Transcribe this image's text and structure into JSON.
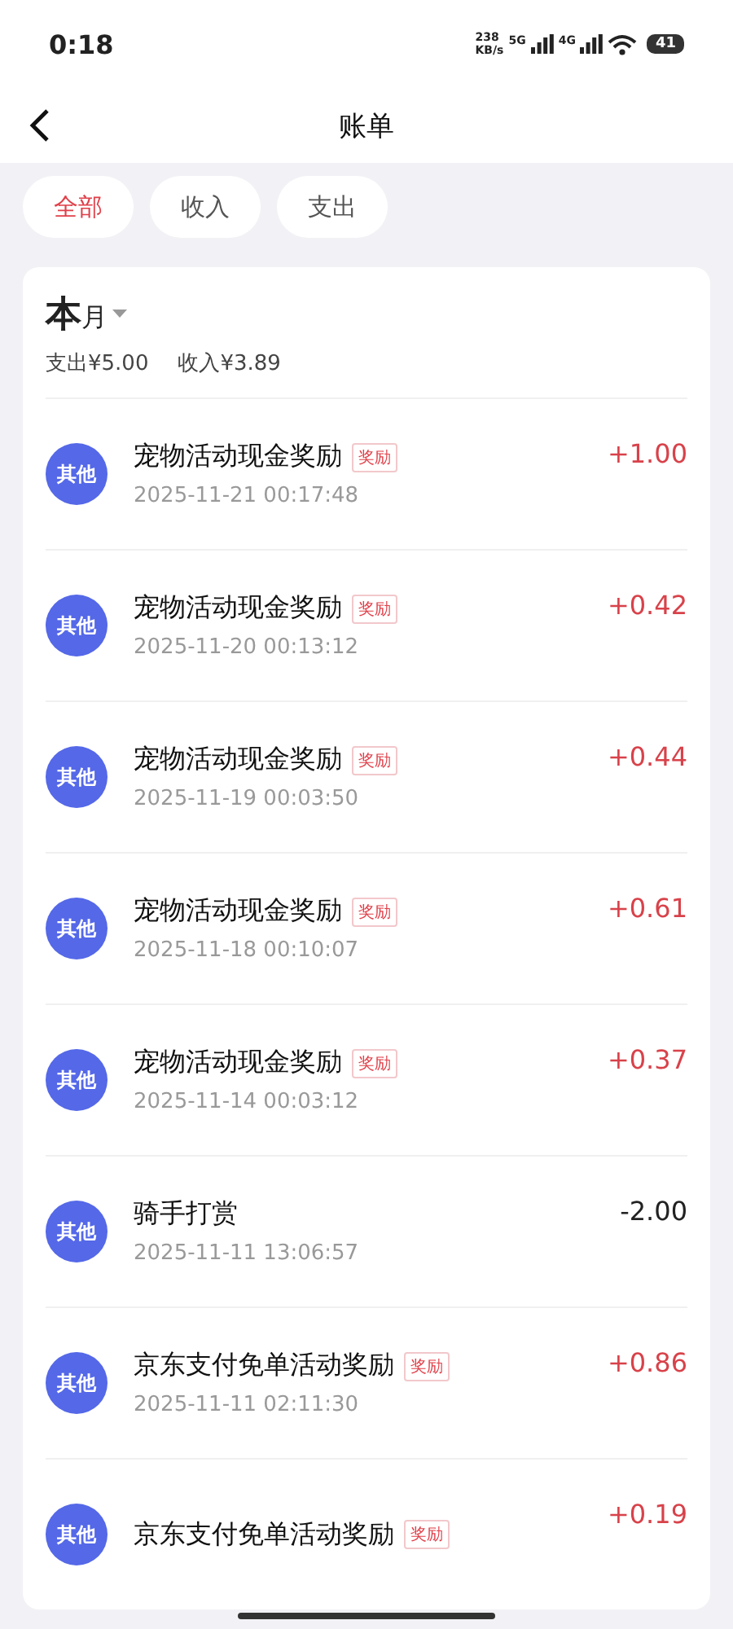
{
  "status_bar": {
    "time": "0:18",
    "net_speed": "238",
    "net_unit": "KB/s",
    "signal_1": "5G",
    "signal_2": "4G",
    "battery": "41"
  },
  "nav": {
    "title": "账单"
  },
  "filters": [
    {
      "label": "全部",
      "selected": true
    },
    {
      "label": "收入",
      "selected": false
    },
    {
      "label": "支出",
      "selected": false
    }
  ],
  "period": {
    "big": "本",
    "small": "月",
    "expense": "支出¥5.00",
    "income": "收入¥3.89"
  },
  "records": [
    {
      "category": "其他",
      "title": "宠物活动现金奖励",
      "tag": "奖励",
      "time": "2025-11-21 00:17:48",
      "amount": "+1.00",
      "kind": "income"
    },
    {
      "category": "其他",
      "title": "宠物活动现金奖励",
      "tag": "奖励",
      "time": "2025-11-20 00:13:12",
      "amount": "+0.42",
      "kind": "income"
    },
    {
      "category": "其他",
      "title": "宠物活动现金奖励",
      "tag": "奖励",
      "time": "2025-11-19 00:03:50",
      "amount": "+0.44",
      "kind": "income"
    },
    {
      "category": "其他",
      "title": "宠物活动现金奖励",
      "tag": "奖励",
      "time": "2025-11-18 00:10:07",
      "amount": "+0.61",
      "kind": "income"
    },
    {
      "category": "其他",
      "title": "宠物活动现金奖励",
      "tag": "奖励",
      "time": "2025-11-14 00:03:12",
      "amount": "+0.37",
      "kind": "income"
    },
    {
      "category": "其他",
      "title": "骑手打赏",
      "time": "2025-11-11 13:06:57",
      "amount": "-2.00",
      "kind": "expense"
    },
    {
      "category": "其他",
      "title": "京东支付免单活动奖励",
      "tag": "奖励",
      "time": "2025-11-11 02:11:30",
      "amount": "+0.86",
      "kind": "income"
    },
    {
      "category": "其他",
      "title": "京东支付免单活动奖励",
      "tag": "奖励",
      "amount": "+0.19",
      "kind": "income"
    }
  ]
}
